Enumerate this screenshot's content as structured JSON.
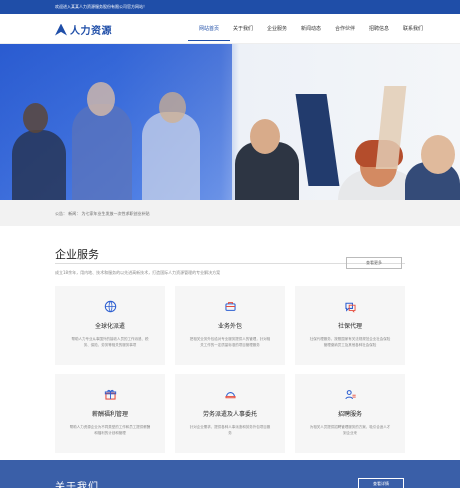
{
  "topbar": {
    "text": "欢迎进入某某人力资源服务股份有限公司官方网站！"
  },
  "header": {
    "logo_text": "人力资源"
  },
  "nav": {
    "items": [
      {
        "label": "网站首页",
        "active": true
      },
      {
        "label": "关于我们",
        "active": false
      },
      {
        "label": "企业服务",
        "active": false
      },
      {
        "label": "新闻动态",
        "active": false
      },
      {
        "label": "合作伙伴",
        "active": false
      },
      {
        "label": "招聘信息",
        "active": false
      },
      {
        "label": "联系我们",
        "active": false
      }
    ]
  },
  "notice": {
    "label": "公告：",
    "text": "新闻： 为七家年业生发放一次性求职创业补贴"
  },
  "services": {
    "title": "企业服务",
    "subtitle": "成立18余年，用内地、技术和服务的以先进高新技术，打造国际人力资源管理的专业解决方案",
    "more": "查看更多",
    "cards": [
      {
        "title": "全球化派遣",
        "desc": "帮助人力专业从事国外的接收人员的工作派遣、税务、保险、劳务等相关的服务事项",
        "icon": "globe-icon"
      },
      {
        "title": "业务外包",
        "desc": "把相关业务外包给对专业服务提供人的管理，针对相关工作的一定质量标准的项目管理服务",
        "icon": "briefcase-icon"
      },
      {
        "title": "社保代理",
        "desc": "社保代理服务，按照国家有关法规规范企业社会保险管理缴纳员工及其他各种社会保险",
        "icon": "chat-icon"
      },
      {
        "title": "薪酬福利管理",
        "desc": "帮助人力资源企业为不同类型的工作和员工提供薪酬和福利的计划和管理",
        "icon": "gift-icon"
      },
      {
        "title": "劳务派遣及人事委托",
        "desc": "针对企业需求，提供各种人事派遣和劳务外包项目服务",
        "icon": "helmet-icon"
      },
      {
        "title": "招聘服务",
        "desc": "为相关人员提供招聘管理服务的方案，吸引合适人才到企业来",
        "icon": "people-icon"
      }
    ]
  },
  "about": {
    "title": "关于我们",
    "button": "查看详情"
  },
  "colors": {
    "brand": "#1f4ea8",
    "card_bg": "#f6f6f6",
    "icon": "#2d5fd1",
    "icon_red": "#e64b3c"
  }
}
